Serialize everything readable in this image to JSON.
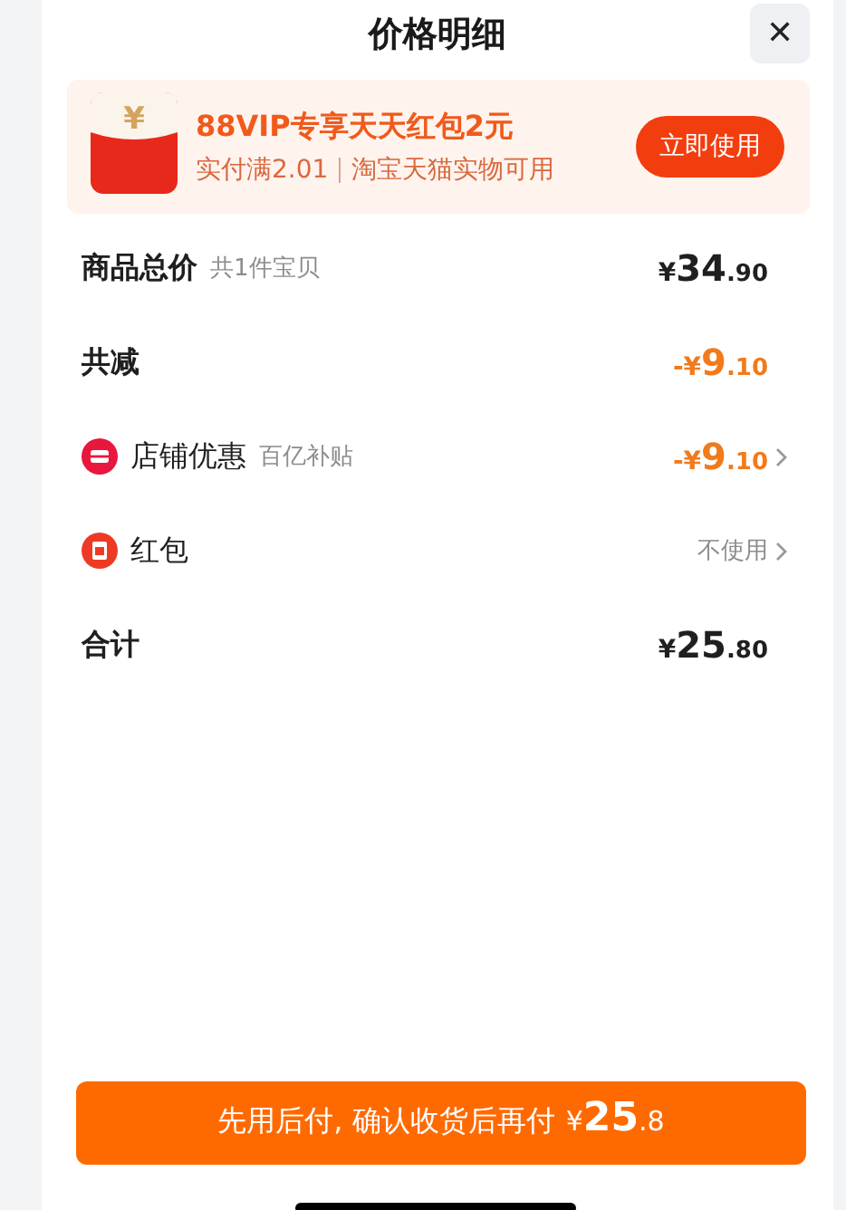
{
  "header": {
    "title": "价格明细",
    "close": "✕"
  },
  "promo": {
    "title": "88VIP专享天天红包2元",
    "condition": "实付满2.01",
    "scope": "淘宝天猫实物可用",
    "button": "立即使用",
    "icon_symbol": "¥"
  },
  "rows": [
    {
      "kind": "plain",
      "label": "商品总价",
      "note": "共1件宝贝",
      "amount": {
        "kind": "normal",
        "prefix": "¥",
        "whole": "34",
        "fraction": ".90"
      },
      "chevron": false
    },
    {
      "kind": "plain",
      "label": "共减",
      "amount": {
        "kind": "discount",
        "prefix": "-¥",
        "whole": "9",
        "fraction": ".10"
      },
      "chevron": false
    },
    {
      "kind": "shop",
      "label": "店铺优惠",
      "note": "百亿补贴",
      "amount": {
        "kind": "discount",
        "prefix": "-¥",
        "whole": "9",
        "fraction": ".10"
      },
      "chevron": true
    },
    {
      "kind": "red-packet",
      "label": "红包",
      "status": "不使用",
      "chevron": true
    },
    {
      "kind": "plain",
      "label": "合计",
      "amount": {
        "kind": "normal",
        "prefix": "¥",
        "whole": "25",
        "fraction": ".80"
      },
      "chevron": false
    }
  ],
  "pay_button": {
    "text": "先用后付, 确认收货后再付",
    "prefix": "¥",
    "whole": "25",
    "fraction": ".8"
  }
}
